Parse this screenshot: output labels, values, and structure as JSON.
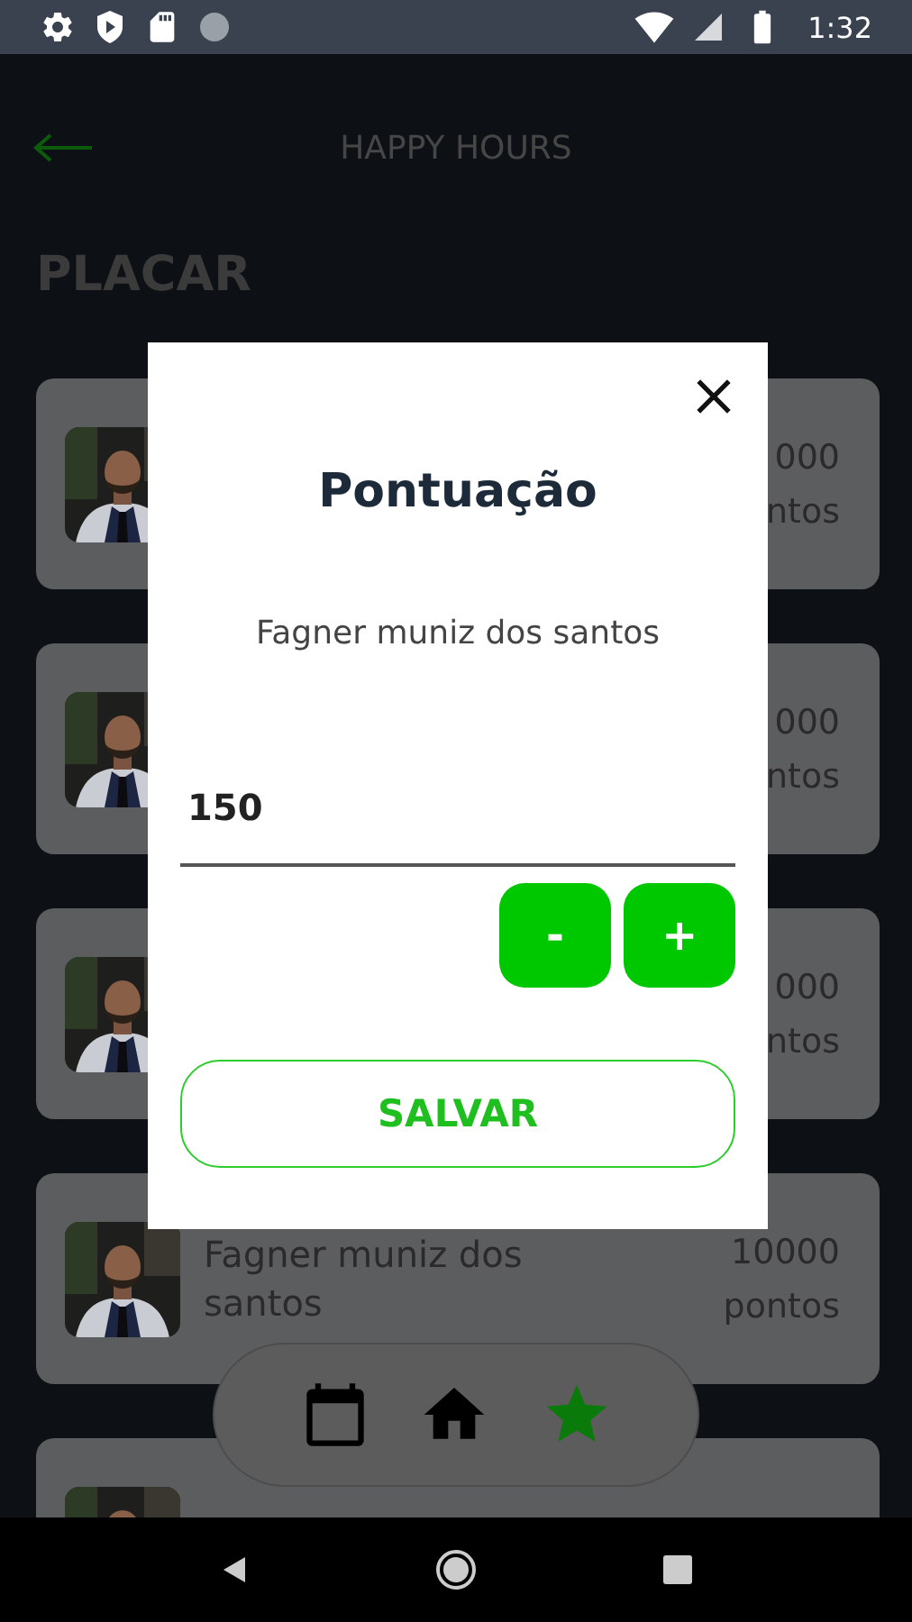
{
  "status_bar": {
    "time": "1:32"
  },
  "header": {
    "title": "HAPPY HOURS"
  },
  "section_title": "PLACAR",
  "ranking": [
    {
      "avatar": {
        "kind": "picture"
      },
      "points": "000",
      "unit": "ntos"
    },
    {
      "avatar": {
        "kind": "picture"
      },
      "points": "000",
      "unit": "ntos"
    },
    {
      "avatar": {
        "kind": "picture"
      },
      "points": "000",
      "unit": "ntos"
    },
    {
      "avatar": {
        "kind": "picture"
      },
      "name": "Fagner muniz dos santos",
      "points": "10000",
      "unit": "pontos"
    },
    {
      "avatar": {
        "kind": "picture"
      }
    }
  ],
  "bottom_nav": [
    {
      "kind": "calendar",
      "selected": false
    },
    {
      "kind": "home",
      "selected": false
    },
    {
      "kind": "star",
      "selected": true
    }
  ],
  "dialog": {
    "title": "Pontuação",
    "name": "Fagner muniz dos santos",
    "score": {
      "value": "150"
    },
    "steppers": [
      {
        "label": "-"
      },
      {
        "label": "+"
      }
    ],
    "save_button": "SALVAR"
  }
}
